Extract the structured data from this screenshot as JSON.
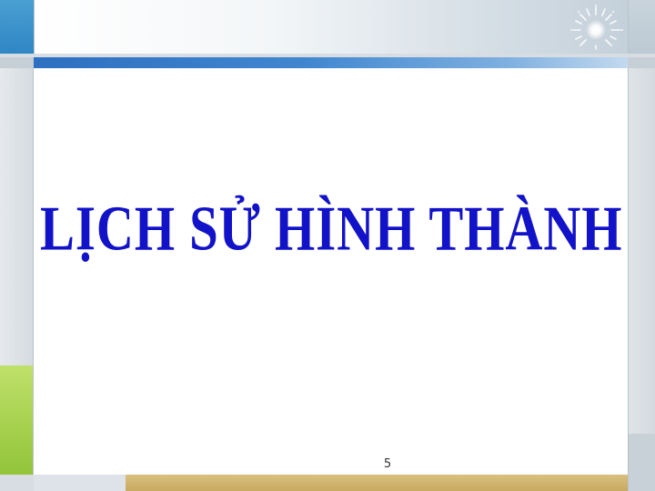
{
  "slide": {
    "title": "LỊCH SỬ HÌNH THÀNH",
    "page_number": "5"
  },
  "logo": {
    "icon": "sparkle-burst-icon"
  },
  "colors": {
    "title": "#1212c8",
    "accent_blue": "#2d6fc0",
    "accent_green": "#9ccc45",
    "accent_gold": "#cdb06a"
  }
}
